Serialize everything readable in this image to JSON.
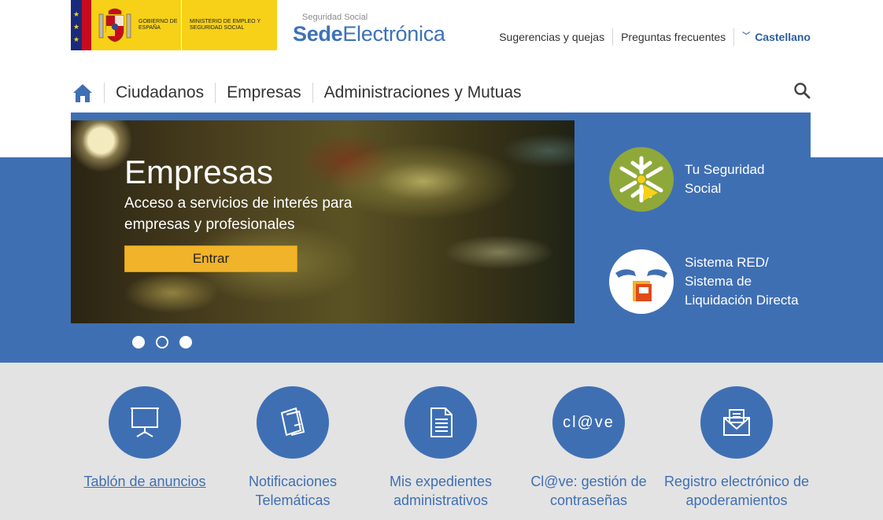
{
  "header": {
    "gov_logo": {
      "line1": "GOBIERNO DE ESPAÑA",
      "line2": "MINISTERIO DE EMPLEO Y SEGURIDAD SOCIAL"
    },
    "sede_logo": {
      "small": "Seguridad Social",
      "bold": "Sede",
      "light": "Electrónica"
    },
    "links": [
      "Sugerencias y quejas",
      "Preguntas frecuentes"
    ],
    "language": "Castellano"
  },
  "nav": {
    "items": [
      "Ciudadanos",
      "Empresas",
      "Administraciones y Mutuas"
    ]
  },
  "hero": {
    "title": "Empresas",
    "subtitle": "Acceso a servicios de interés para empresas y profesionales",
    "button": "Entrar",
    "slide_count": 3,
    "active_slide": 2
  },
  "side_links": [
    {
      "label": "Tu Seguridad Social",
      "icon": "tu-seguridad-social-icon"
    },
    {
      "label": "Sistema RED/ Sistema de Liquidación Directa",
      "icon": "sistema-red-icon"
    }
  ],
  "tiles": [
    {
      "label": "Tablón de anuncios",
      "icon": "presentation-board-icon"
    },
    {
      "label": "Notificaciones Telemáticas",
      "icon": "notification-document-icon"
    },
    {
      "label": "Mis expedientes administrativos",
      "icon": "document-icon"
    },
    {
      "label": "Cl@ve: gestión de contraseñas",
      "icon": "clave-logo-icon",
      "logo_text": "cl@ve"
    },
    {
      "label": "Registro electrónico de apoderamientos",
      "icon": "envelope-icon"
    }
  ],
  "colors": {
    "primary_blue": "#3f6fb3",
    "gov_yellow": "#f7d117",
    "button_orange": "#f1b32a",
    "gray_bg": "#e3e3e3"
  }
}
